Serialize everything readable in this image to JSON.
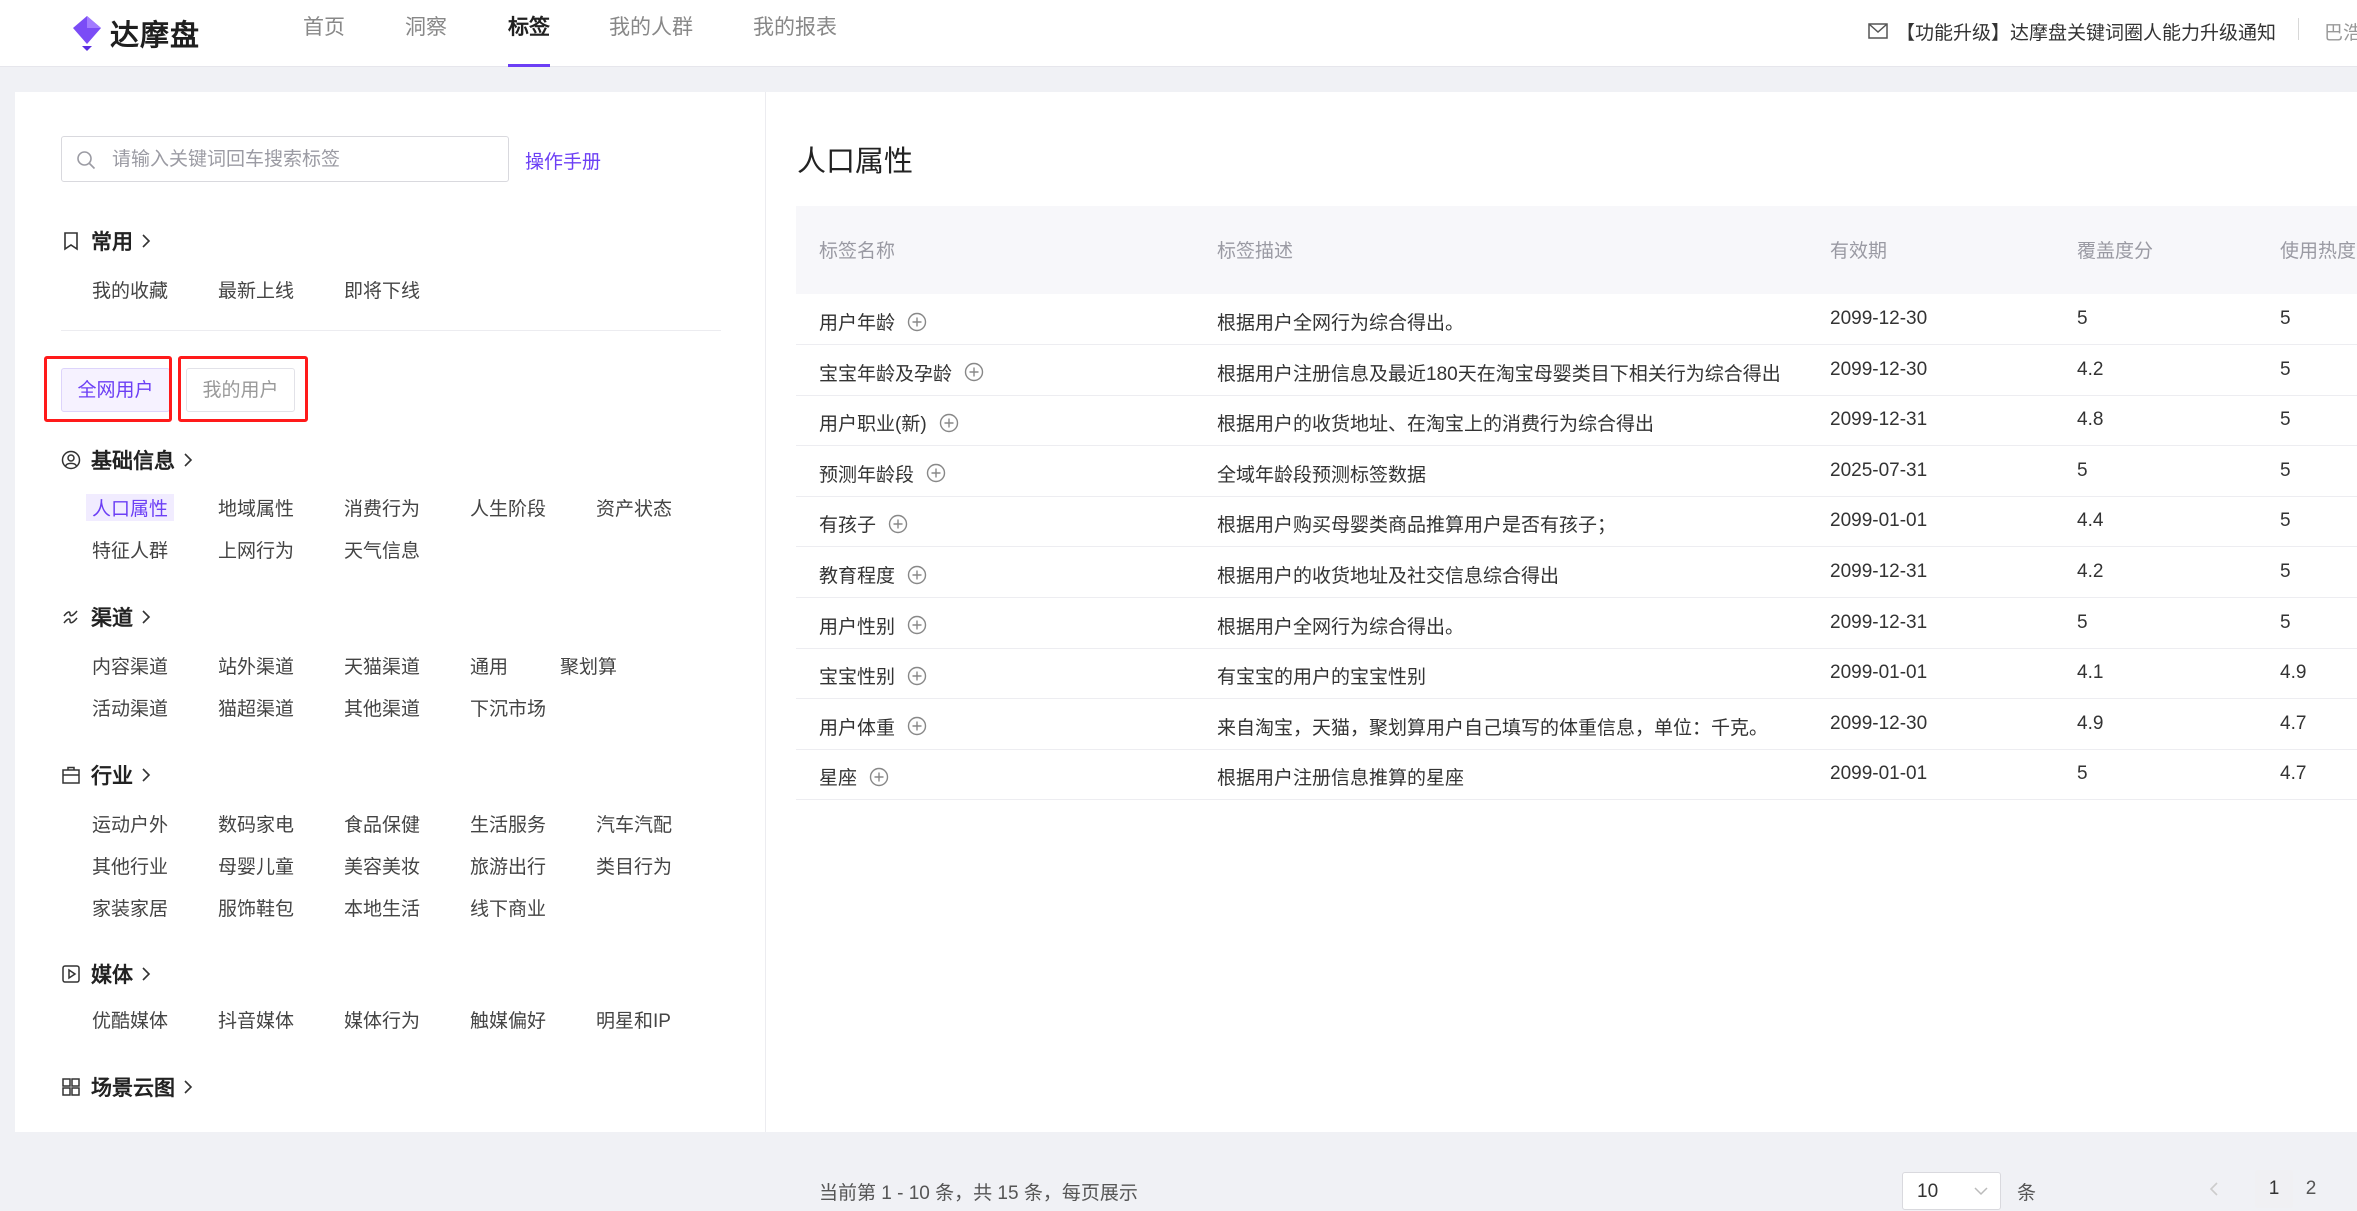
{
  "brand": {
    "name": "达摩盘",
    "accent": "#6c3ff5"
  },
  "nav": {
    "items": [
      "首页",
      "洞察",
      "标签",
      "我的人群",
      "我的报表"
    ],
    "active_index": 2
  },
  "header": {
    "notice_icon": "mail-icon",
    "notice": "【功能升级】达摩盘关键词圈人能力升级通知",
    "user": "巴浩"
  },
  "sidebar": {
    "search_placeholder": "请输入关键词回车搜索标签",
    "search_value": "",
    "manual_link": "操作手册",
    "common": {
      "title": "常用",
      "icon": "bookmark-icon",
      "items": [
        "我的收藏",
        "最新上线",
        "即将下线"
      ]
    },
    "user_tabs": {
      "active": "全网用户",
      "inactive": "我的用户",
      "highlight_color": "#ff1a1a"
    },
    "groups": [
      {
        "title": "基础信息",
        "icon": "user-circle-icon",
        "items": [
          "人口属性",
          "地域属性",
          "消费行为",
          "人生阶段",
          "资产状态",
          "特征人群",
          "上网行为",
          "天气信息"
        ],
        "active_item": "人口属性"
      },
      {
        "title": "渠道",
        "icon": "channel-icon",
        "items": [
          "内容渠道",
          "站外渠道",
          "天猫渠道",
          "通用",
          "聚划算",
          "活动渠道",
          "猫超渠道",
          "其他渠道",
          "下沉市场"
        ]
      },
      {
        "title": "行业",
        "icon": "briefcase-icon",
        "items": [
          "运动户外",
          "数码家电",
          "食品保健",
          "生活服务",
          "汽车汽配",
          "其他行业",
          "母婴儿童",
          "美容美妆",
          "旅游出行",
          "类目行为",
          "家装家居",
          "服饰鞋包",
          "本地生活",
          "线下商业"
        ]
      },
      {
        "title": "媒体",
        "icon": "play-icon",
        "items": [
          "优酷媒体",
          "抖音媒体",
          "媒体行为",
          "触媒偏好",
          "明星和IP"
        ]
      },
      {
        "title": "场景云图",
        "icon": "grid-icon",
        "items": []
      }
    ]
  },
  "main": {
    "title": "人口属性",
    "columns": [
      "标签名称",
      "标签描述",
      "有效期",
      "覆盖度分",
      "使用热度分"
    ],
    "rows": [
      {
        "name": "用户年龄",
        "desc": "根据用户全网行为综合得出。",
        "expiry": "2099-12-30",
        "coverage": "5",
        "heat": "5"
      },
      {
        "name": "宝宝年龄及孕龄",
        "desc": "根据用户注册信息及最近180天在淘宝母婴类目下相关行为综合得出",
        "expiry": "2099-12-30",
        "coverage": "4.2",
        "heat": "5"
      },
      {
        "name": "用户职业(新)",
        "desc": "根据用户的收货地址、在淘宝上的消费行为综合得出",
        "expiry": "2099-12-31",
        "coverage": "4.8",
        "heat": "5"
      },
      {
        "name": "预测年龄段",
        "desc": "全域年龄段预测标签数据",
        "expiry": "2025-07-31",
        "coverage": "5",
        "heat": "5"
      },
      {
        "name": "有孩子",
        "desc": "根据用户购买母婴类商品推算用户是否有孩子；",
        "expiry": "2099-01-01",
        "coverage": "4.4",
        "heat": "5"
      },
      {
        "name": "教育程度",
        "desc": "根据用户的收货地址及社交信息综合得出",
        "expiry": "2099-12-31",
        "coverage": "4.2",
        "heat": "5"
      },
      {
        "name": "用户性别",
        "desc": "根据用户全网行为综合得出。",
        "expiry": "2099-12-31",
        "coverage": "5",
        "heat": "5"
      },
      {
        "name": "宝宝性别",
        "desc": "有宝宝的用户的宝宝性别",
        "expiry": "2099-01-01",
        "coverage": "4.1",
        "heat": "4.9"
      },
      {
        "name": "用户体重",
        "desc": "来自淘宝，天猫，聚划算用户自己填写的体重信息，单位：千克。",
        "expiry": "2099-12-30",
        "coverage": "4.9",
        "heat": "4.7"
      },
      {
        "name": "星座",
        "desc": "根据用户注册信息推算的星座",
        "expiry": "2099-01-01",
        "coverage": "5",
        "heat": "4.7"
      }
    ],
    "pagination": {
      "summary": "当前第 1 - 10 条，共 15 条，每页展示",
      "page_size": "10",
      "unit": "条",
      "pages": [
        "1",
        "2"
      ],
      "current": "1"
    }
  }
}
